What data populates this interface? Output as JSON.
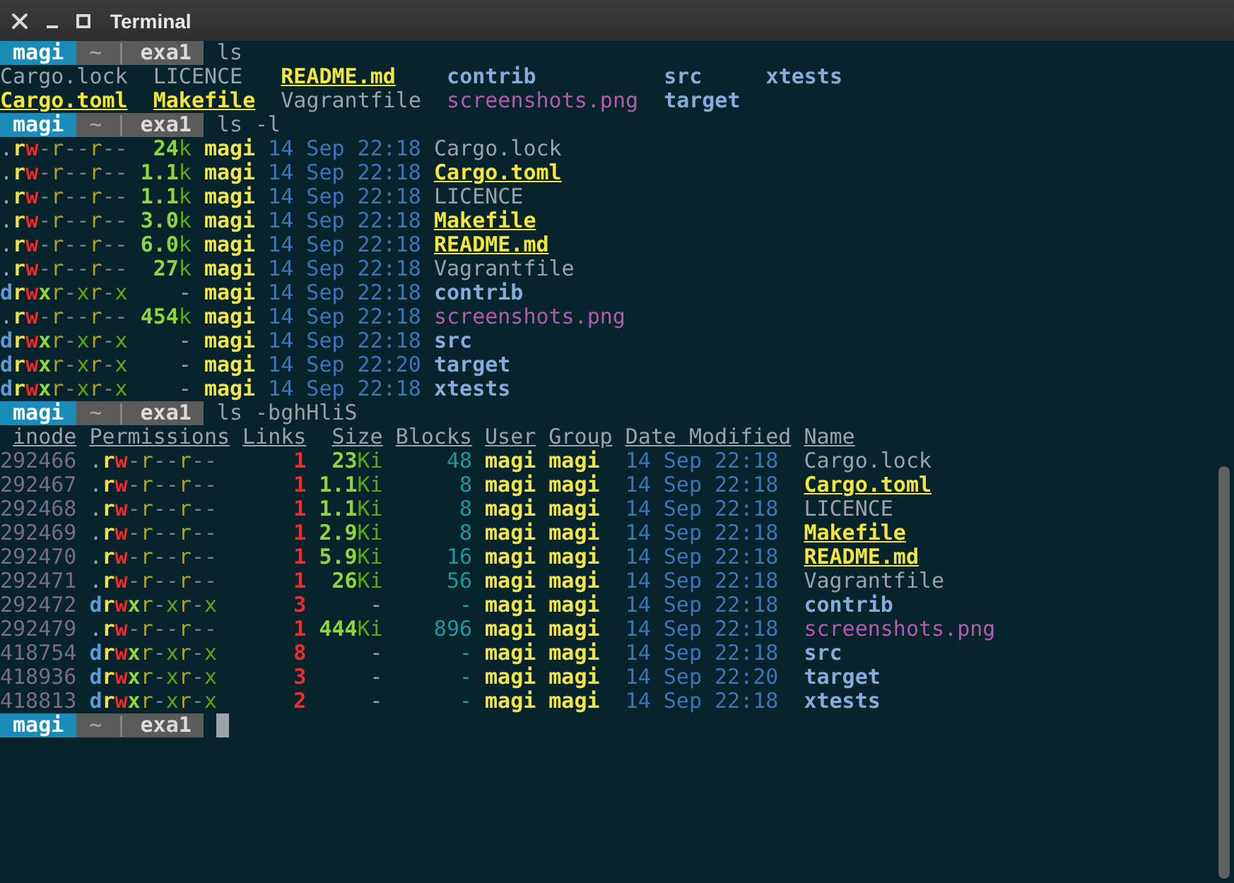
{
  "window": {
    "title": "Terminal"
  },
  "session": [
    {
      "kind": "prompt",
      "user": "magi",
      "dir": "~",
      "separator": "|",
      "host": "exa1",
      "command": "ls"
    },
    {
      "kind": "grid",
      "rows": [
        [
          {
            "name": "Cargo.lock",
            "kind": "plain"
          },
          {
            "name": "LICENCE",
            "kind": "plain"
          },
          {
            "name": "README.md",
            "kind": "special"
          },
          {
            "name": "contrib",
            "kind": "directory"
          },
          {
            "name": "src",
            "kind": "directory"
          },
          {
            "name": "xtests",
            "kind": "directory"
          }
        ],
        [
          {
            "name": "Cargo.toml",
            "kind": "special"
          },
          {
            "name": "Makefile",
            "kind": "special"
          },
          {
            "name": "Vagrantfile",
            "kind": "plain"
          },
          {
            "name": "screenshots.png",
            "kind": "image"
          },
          {
            "name": "target",
            "kind": "directory"
          }
        ]
      ]
    },
    {
      "kind": "prompt",
      "user": "magi",
      "dir": "~",
      "separator": "|",
      "host": "exa1",
      "command": "ls -l"
    },
    {
      "kind": "long",
      "rows": [
        {
          "permissions": ".rw-r--r--",
          "size": "24",
          "unit": "k",
          "user": "magi",
          "date": "14 Sep 22:18",
          "name": "Cargo.lock",
          "kind": "plain"
        },
        {
          "permissions": ".rw-r--r--",
          "size": "1.1",
          "unit": "k",
          "user": "magi",
          "date": "14 Sep 22:18",
          "name": "Cargo.toml",
          "kind": "special"
        },
        {
          "permissions": ".rw-r--r--",
          "size": "1.1",
          "unit": "k",
          "user": "magi",
          "date": "14 Sep 22:18",
          "name": "LICENCE",
          "kind": "plain"
        },
        {
          "permissions": ".rw-r--r--",
          "size": "3.0",
          "unit": "k",
          "user": "magi",
          "date": "14 Sep 22:18",
          "name": "Makefile",
          "kind": "special"
        },
        {
          "permissions": ".rw-r--r--",
          "size": "6.0",
          "unit": "k",
          "user": "magi",
          "date": "14 Sep 22:18",
          "name": "README.md",
          "kind": "special"
        },
        {
          "permissions": ".rw-r--r--",
          "size": "27",
          "unit": "k",
          "user": "magi",
          "date": "14 Sep 22:18",
          "name": "Vagrantfile",
          "kind": "plain"
        },
        {
          "permissions": "drwxr-xr-x",
          "size": "-",
          "user": "magi",
          "date": "14 Sep 22:18",
          "name": "contrib",
          "kind": "directory"
        },
        {
          "permissions": ".rw-r--r--",
          "size": "454",
          "unit": "k",
          "user": "magi",
          "date": "14 Sep 22:18",
          "name": "screenshots.png",
          "kind": "image"
        },
        {
          "permissions": "drwxr-xr-x",
          "size": "-",
          "user": "magi",
          "date": "14 Sep 22:18",
          "name": "src",
          "kind": "directory"
        },
        {
          "permissions": "drwxr-xr-x",
          "size": "-",
          "user": "magi",
          "date": "14 Sep 22:20",
          "name": "target",
          "kind": "directory"
        },
        {
          "permissions": "drwxr-xr-x",
          "size": "-",
          "user": "magi",
          "date": "14 Sep 22:18",
          "name": "xtests",
          "kind": "directory"
        }
      ]
    },
    {
      "kind": "prompt",
      "user": "magi",
      "dir": "~",
      "separator": "|",
      "host": "exa1",
      "command": "ls -bghHliS"
    },
    {
      "kind": "table",
      "columns": [
        "inode",
        "Permissions",
        "Links",
        "Size",
        "Blocks",
        "User",
        "Group",
        "Date Modified",
        "Name"
      ],
      "rows": [
        {
          "inode": "292466",
          "permissions": ".rw-r--r--",
          "links": "1",
          "size": "23",
          "unit": "Ki",
          "blocks": "48",
          "user": "magi",
          "group": "magi",
          "date": "14 Sep 22:18",
          "name": "Cargo.lock",
          "kind": "plain"
        },
        {
          "inode": "292467",
          "permissions": ".rw-r--r--",
          "links": "1",
          "size": "1.1",
          "unit": "Ki",
          "blocks": "8",
          "user": "magi",
          "group": "magi",
          "date": "14 Sep 22:18",
          "name": "Cargo.toml",
          "kind": "special"
        },
        {
          "inode": "292468",
          "permissions": ".rw-r--r--",
          "links": "1",
          "size": "1.1",
          "unit": "Ki",
          "blocks": "8",
          "user": "magi",
          "group": "magi",
          "date": "14 Sep 22:18",
          "name": "LICENCE",
          "kind": "plain"
        },
        {
          "inode": "292469",
          "permissions": ".rw-r--r--",
          "links": "1",
          "size": "2.9",
          "unit": "Ki",
          "blocks": "8",
          "user": "magi",
          "group": "magi",
          "date": "14 Sep 22:18",
          "name": "Makefile",
          "kind": "special"
        },
        {
          "inode": "292470",
          "permissions": ".rw-r--r--",
          "links": "1",
          "size": "5.9",
          "unit": "Ki",
          "blocks": "16",
          "user": "magi",
          "group": "magi",
          "date": "14 Sep 22:18",
          "name": "README.md",
          "kind": "special"
        },
        {
          "inode": "292471",
          "permissions": ".rw-r--r--",
          "links": "1",
          "size": "26",
          "unit": "Ki",
          "blocks": "56",
          "user": "magi",
          "group": "magi",
          "date": "14 Sep 22:18",
          "name": "Vagrantfile",
          "kind": "plain"
        },
        {
          "inode": "292472",
          "permissions": "drwxr-xr-x",
          "links": "3",
          "size": "-",
          "blocks": "-",
          "user": "magi",
          "group": "magi",
          "date": "14 Sep 22:18",
          "name": "contrib",
          "kind": "directory"
        },
        {
          "inode": "292479",
          "permissions": ".rw-r--r--",
          "links": "1",
          "size": "444",
          "unit": "Ki",
          "blocks": "896",
          "user": "magi",
          "group": "magi",
          "date": "14 Sep 22:18",
          "name": "screenshots.png",
          "kind": "image"
        },
        {
          "inode": "418754",
          "permissions": "drwxr-xr-x",
          "links": "8",
          "size": "-",
          "blocks": "-",
          "user": "magi",
          "group": "magi",
          "date": "14 Sep 22:18",
          "name": "src",
          "kind": "directory"
        },
        {
          "inode": "418936",
          "permissions": "drwxr-xr-x",
          "links": "3",
          "size": "-",
          "blocks": "-",
          "user": "magi",
          "group": "magi",
          "date": "14 Sep 22:20",
          "name": "target",
          "kind": "directory"
        },
        {
          "inode": "418813",
          "permissions": "drwxr-xr-x",
          "links": "2",
          "size": "-",
          "blocks": "-",
          "user": "magi",
          "group": "magi",
          "date": "14 Sep 22:18",
          "name": "xtests",
          "kind": "directory"
        }
      ]
    },
    {
      "kind": "prompt",
      "user": "magi",
      "dir": "~",
      "separator": "|",
      "host": "exa1",
      "cursor": true
    }
  ]
}
